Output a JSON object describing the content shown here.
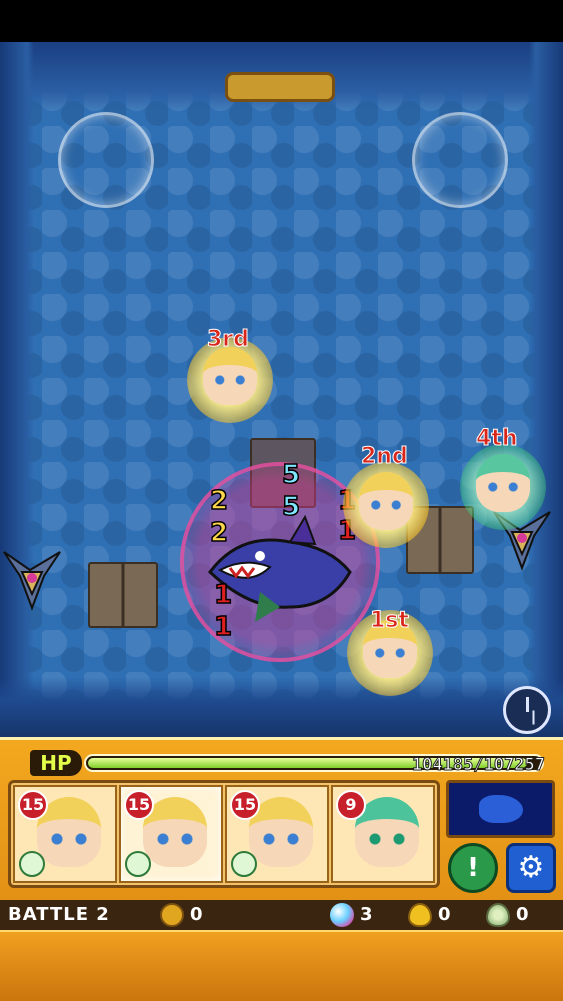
{
  "battlefield": {
    "turn_counters": {
      "left_top": "2",
      "left_bottom": "2",
      "center_top": "5",
      "center_bottom": "5",
      "right_top": "1",
      "right_bottom": "1",
      "boss_top": "1",
      "boss_bottom": "1"
    },
    "units": [
      {
        "rank": "3rd"
      },
      {
        "rank": "2nd"
      },
      {
        "rank": "4th"
      },
      {
        "rank": "1st"
      }
    ],
    "speed_icon": "clock-icon"
  },
  "hp": {
    "label": "HP",
    "current": 104185,
    "max": 107257,
    "text": "104185/107257",
    "fill_fraction": 0.971
  },
  "party": [
    {
      "level": "15",
      "element": "wood",
      "active": false
    },
    {
      "level": "15",
      "element": "wood",
      "active": true
    },
    {
      "level": "15",
      "element": "wood",
      "active": false
    },
    {
      "level": "9",
      "element": "wood",
      "active": false
    }
  ],
  "controls": {
    "strike_label": "!",
    "settings_icon": "gear-icon",
    "radar_icon": "boss-radar-icon"
  },
  "status": {
    "battle_label": "BATTLE",
    "battle_number": "2",
    "coins": "0",
    "orbs": "3",
    "gold_eggs": "0",
    "silver_eggs": "0"
  }
}
